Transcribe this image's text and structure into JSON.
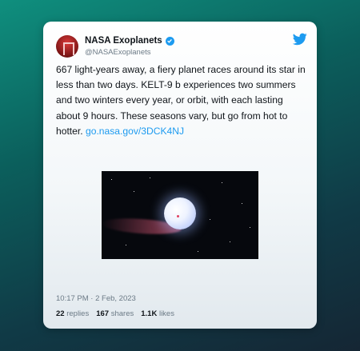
{
  "author": {
    "display_name": "NASA Exoplanets",
    "handle": "@NASAExoplanets",
    "verified_icon": "verified-badge-icon"
  },
  "brand_icon": "twitter-bird-icon",
  "colors": {
    "accent": "#1d9bf0",
    "text": "#0f1419",
    "muted": "#6b7a86"
  },
  "tweet": {
    "text": "667 light-years away, a fiery planet races around its star in less than two days. KELT-9 b experiences two summers and two winters every year, or orbit, with each lasting about 9 hours. These seasons vary, but go from hot to hotter.",
    "link": "go.nasa.gov/3DCK4NJ"
  },
  "timestamp": "10:17 PM · 2 Feb, 2023",
  "stats": {
    "replies_count": "22",
    "replies_label": "replies",
    "shares_count": "167",
    "shares_label": "shares",
    "likes_count": "1.1K",
    "likes_label": "likes"
  }
}
